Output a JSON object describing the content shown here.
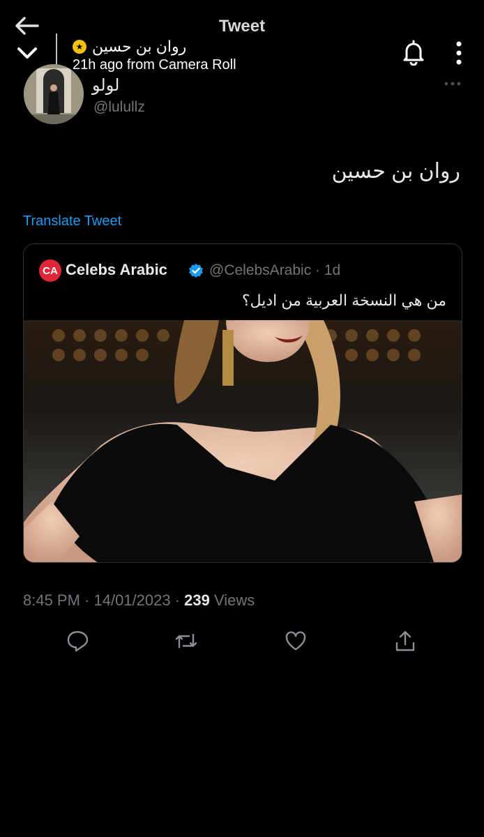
{
  "header": {
    "title": "Tweet",
    "story_name": "روان بن حسين",
    "story_meta": "21h ago from Camera Roll"
  },
  "tweet": {
    "display_name": "لولو",
    "handle": "@lulullz",
    "text": "روان بن حسين",
    "translate_label": "Translate Tweet",
    "timestamp": "8:45 PM · 14/01/2023 ·",
    "views_count": "239",
    "views_label": "Views"
  },
  "quote": {
    "logo_text": "CA",
    "name": "Celebs Arabic",
    "handle": "@CelebsArabic · 1d",
    "text": "من هي النسخة العربية من اديل؟"
  },
  "icons": [
    "back-arrow-icon",
    "chevron-down-icon",
    "star-icon",
    "bell-icon",
    "menu-icon",
    "more-icon",
    "verified-icon",
    "reply-icon",
    "retweet-icon",
    "like-icon",
    "share-icon"
  ],
  "colors": {
    "accent": "#1d9bf0",
    "muted": "#71767b",
    "logo": "#e2263a"
  }
}
